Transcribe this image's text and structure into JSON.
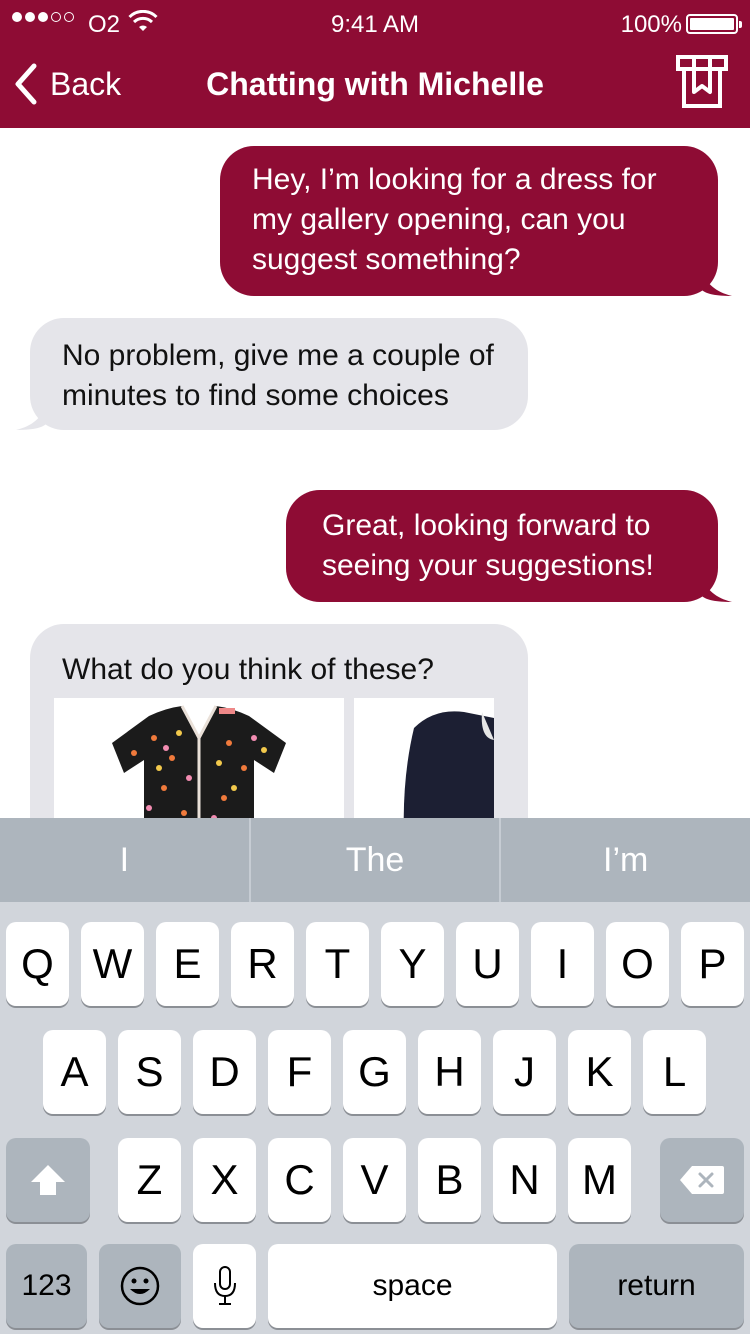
{
  "status_bar": {
    "carrier": "O2",
    "time": "9:41 AM",
    "battery": "100%"
  },
  "nav": {
    "back_label": "Back",
    "title": "Chatting with Michelle"
  },
  "messages": [
    {
      "direction": "outgoing",
      "text": "Hey, I’m looking for a dress for my gallery opening, can you suggest something?"
    },
    {
      "direction": "incoming",
      "text": "No problem, give me a couple of minutes to find some choices"
    },
    {
      "direction": "outgoing",
      "text": "Great, looking forward to seeing your suggestions!"
    },
    {
      "direction": "incoming",
      "text": "What do you think of these?"
    }
  ],
  "keyboard": {
    "suggestions": [
      "I",
      "The",
      "I’m"
    ],
    "row1": [
      "Q",
      "W",
      "E",
      "R",
      "T",
      "Y",
      "U",
      "I",
      "O",
      "P"
    ],
    "row2": [
      "A",
      "S",
      "D",
      "F",
      "G",
      "H",
      "J",
      "K",
      "L"
    ],
    "row3": [
      "Z",
      "X",
      "C",
      "V",
      "B",
      "N",
      "M"
    ],
    "numbers_label": "123",
    "space_label": "space",
    "return_label": "return"
  },
  "colors": {
    "brand": "#8e0c34",
    "incoming_bubble": "#e5e5ea",
    "keyboard_bg": "#d1d5db"
  }
}
